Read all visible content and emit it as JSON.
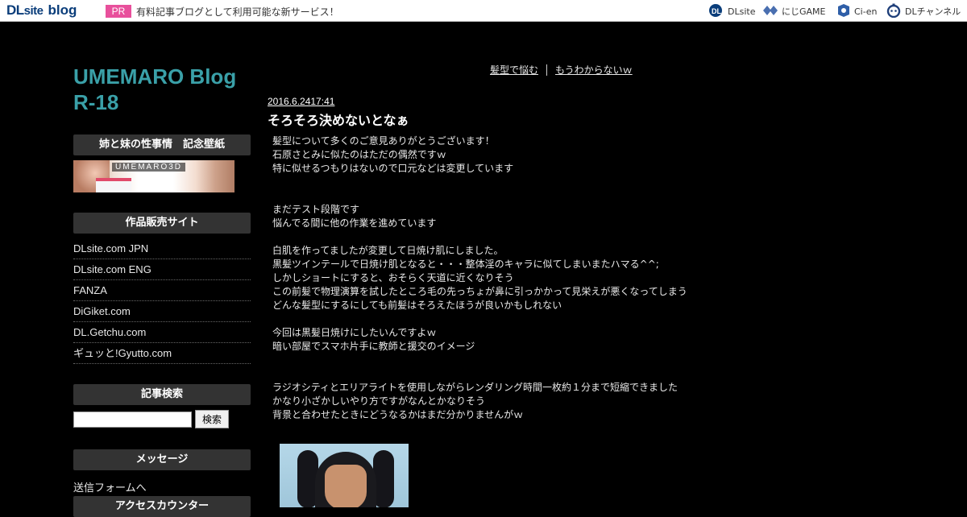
{
  "topbar": {
    "logo_dl": "DL",
    "logo_site": "site",
    "logo_blog": "blog",
    "pr_badge": "PR",
    "pr_text": "有料記事ブログとして利用可能な新サービス！",
    "services": [
      {
        "label": "DLsite",
        "icon": "dlsite-icon"
      },
      {
        "label": "にじGAME",
        "icon": "niji-game-icon"
      },
      {
        "label": "Ci-en",
        "icon": "ci-en-icon"
      },
      {
        "label": "DLチャンネル",
        "icon": "dl-channel-icon"
      }
    ]
  },
  "sidebar": {
    "blog_title": "UMEMARO Blog R-18",
    "wallpaper_heading": "姉と妹の性事情　記念壁紙",
    "banner_brand": "UMEMARO3D",
    "shops_heading": "作品販売サイト",
    "shops": [
      "DLsite.com JPN",
      "DLsite.com ENG",
      "FANZA",
      "DiGiket.com",
      "DL.Getchu.com",
      "ギュッと!Gyutto.com"
    ],
    "search_heading": "記事検索",
    "search_value": "",
    "search_button": "検索",
    "message_heading": "メッセージ",
    "message_link": "送信フォームへ",
    "counter_heading": "アクセスカウンター"
  },
  "main": {
    "nav_prev": "髪型で悩む",
    "nav_next": "もうわからないｗ",
    "date": "2016.6.2417:41",
    "title": "そろそろ決めないとなぁ",
    "body_lines": [
      "髪型について多くのご意見ありがとうございます！",
      "石原さとみに似たのはただの偶然ですｗ",
      "特に似せるつもりはないので口元などは変更しています",
      "",
      "",
      "まだテスト段階です",
      "悩んでる間に他の作業を進めています",
      "",
      "白肌を作ってましたが変更して日焼け肌にしました。",
      "黒髪ツインテールで日焼け肌となると・・・整体淫のキャラに似てしまいまたハマる^^;",
      "しかしショートにすると、おそらく天道に近くなりそう",
      "この前髪で物理演算を試したところ毛の先っちょが鼻に引っかかって見栄えが悪くなってしまう",
      "どんな髪型にするにしても前髪はそろえたほうが良いかもしれない",
      "",
      "今回は黒髪日焼けにしたいんですよｗ",
      "暗い部屋でスマホ片手に教師と援交のイメージ",
      "",
      "",
      "ラジオシティとエリアライトを使用しながらレンダリング時間一枚約１分まで短縮できました",
      "かなり小ざかしいやり方ですがなんとかなりそう",
      "背景と合わせたときにどうなるかはまだ分かりませんがｗ"
    ]
  }
}
